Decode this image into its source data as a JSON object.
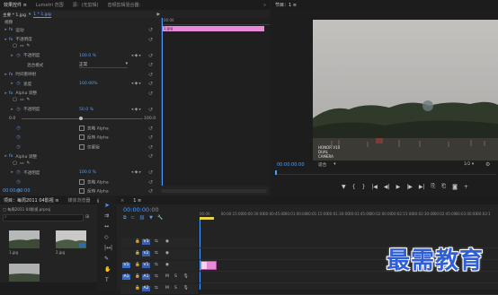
{
  "effects_panel": {
    "tabs": [
      "效果控件 ≡",
      "Lumetri 范围",
      "源：(无剪辑)",
      "音频剪辑混合器："
    ],
    "source_clip": "主要 * 1.jpg",
    "seq_clip": "1 * 1.jpg",
    "section_video": "视频",
    "rows": [
      {
        "label": "运动",
        "kind": "group"
      },
      {
        "label": "不透明度",
        "kind": "group"
      },
      {
        "label": "不透明度",
        "value": "100.0 %",
        "kind": "param"
      },
      {
        "label": "混合模式",
        "value": "正常",
        "kind": "dropdown"
      },
      {
        "label": "时间重映射",
        "kind": "group"
      },
      {
        "label": "速度",
        "value": "100.00%",
        "kind": "param"
      },
      {
        "label": "Alpha 调整",
        "kind": "group"
      },
      {
        "label": "不透明度",
        "value": "50.0 %",
        "kind": "param"
      },
      {
        "label": "0.0",
        "value": "100.0",
        "kind": "slider"
      },
      {
        "label": "",
        "value": "忽略 Alpha",
        "kind": "check"
      },
      {
        "label": "",
        "value": "反转 Alpha",
        "kind": "check"
      },
      {
        "label": "",
        "value": "仅蒙版",
        "kind": "check"
      },
      {
        "label": "Alpha 调整",
        "kind": "group"
      },
      {
        "label": "不透明度",
        "value": "100.0 %",
        "kind": "param"
      },
      {
        "label": "",
        "value": "忽略 Alpha",
        "kind": "check"
      },
      {
        "label": "",
        "value": "反转 Alpha",
        "kind": "check"
      },
      {
        "label": "",
        "value": "仅蒙版",
        "kind": "check"
      }
    ],
    "timecode": "00:00:00:00",
    "mini_timeline_start": "00:00",
    "mini_clip_label": "1.jpg"
  },
  "program_monitor": {
    "tab": "节目：1 ≡",
    "timecode": "00:00:00:00",
    "fit": "适合",
    "ratio": "1/2",
    "watermark": "HONOR V10 DUAL CAMERA"
  },
  "project_panel": {
    "tabs": [
      "项目：每周2011 04影视 ≡",
      "媒体浏览器"
    ],
    "path": "每周2011 04影视.prproj",
    "items": [
      {
        "name": "1.jpg",
        "duration": "5:00"
      },
      {
        "name": "2.jpg",
        "duration": "5:00"
      },
      {
        "name": "",
        "duration": ""
      }
    ]
  },
  "timeline": {
    "tab": "1 ≡",
    "timecode": "00:00:00:00",
    "ruler": [
      "00:00",
      "00:00:15:00",
      "00:00:30:00",
      "00:00:45:00",
      "00:01:00:00",
      "00:01:15:00",
      "00:01:30:00",
      "00:01:45:00",
      "00:02:00:00",
      "00:02:15:00",
      "00:02:30:00",
      "00:02:45:00",
      "00:03:00:00",
      "00:03:1"
    ],
    "tracks": [
      "V3",
      "V2",
      "V1",
      "A1",
      "A2"
    ]
  },
  "brand_watermark": "最需教育",
  "colors": {
    "accent": "#4f9cff",
    "clip": "#e88ad8",
    "bg": "#232323"
  }
}
